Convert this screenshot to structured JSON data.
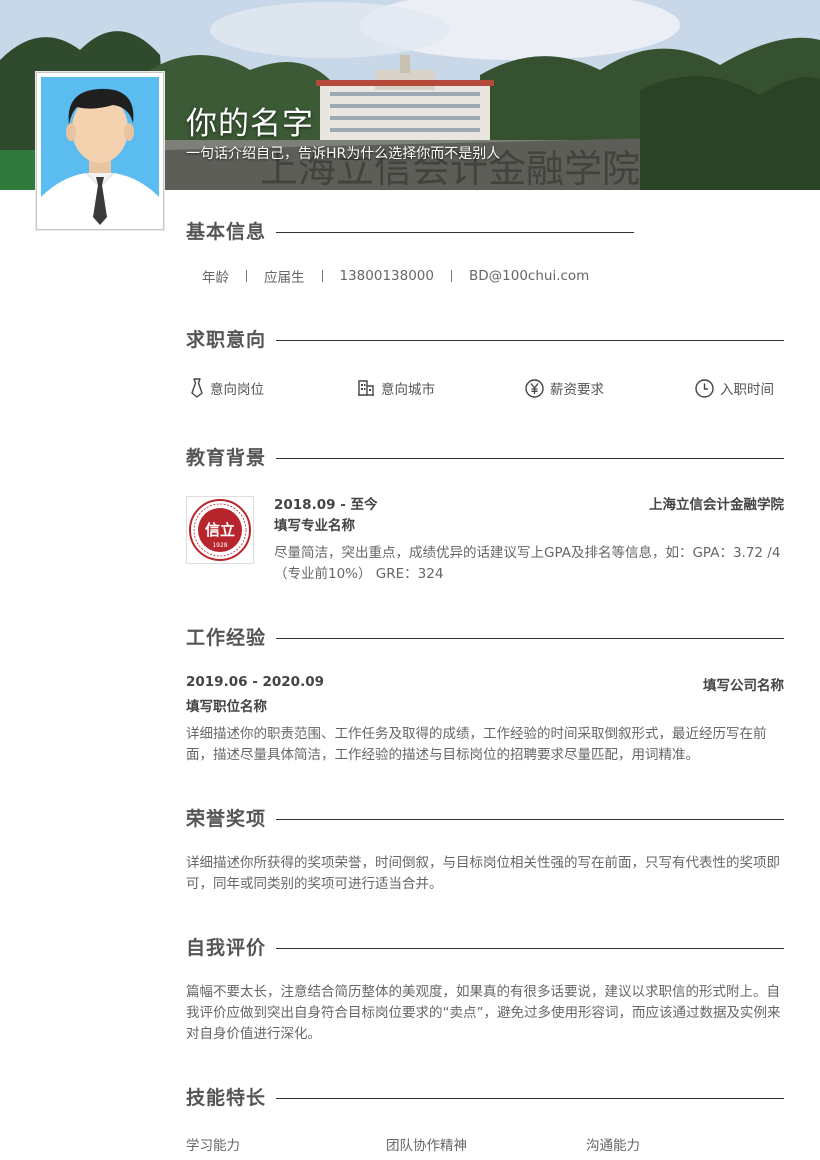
{
  "header": {
    "name": "你的名字",
    "tagline": "一句话介绍自己，告诉HR为什么选择你而不是别人"
  },
  "sections": {
    "basic": "基本信息",
    "intent": "求职意向",
    "education": "教育背景",
    "work": "工作经验",
    "honors": "荣誉奖项",
    "self": "自我评价",
    "skills": "技能特长"
  },
  "basic_info": {
    "age": "年龄",
    "status": "应届生",
    "phone": "13800138000",
    "email": "BD@100chui.com"
  },
  "intent": {
    "position": "意向岗位",
    "city": "意向城市",
    "salary": "薪资要求",
    "start": "入职时间"
  },
  "education": {
    "period": "2018.09 - 至今",
    "school": "上海立信会计金融学院",
    "major": "填写专业名称",
    "desc": "尽量简洁，突出重点，成绩优异的话建议写上GPA及排名等信息，如：GPA：3.72 /4（专业前10%） GRE：324",
    "seal_year": "1928"
  },
  "work": {
    "period": "2019.06 - 2020.09",
    "company": "填写公司名称",
    "position": "填写职位名称",
    "desc": "详细描述你的职责范围、工作任务及取得的成绩，工作经验的时间采取倒叙形式，最近经历写在前面，描述尽量具体简洁，工作经验的描述与目标岗位的招聘要求尽量匹配，用词精准。"
  },
  "honors": {
    "desc": "详细描述你所获得的奖项荣誉，时间倒叙，与目标岗位相关性强的写在前面，只写有代表性的奖项即可，同年或同类别的奖项可进行适当合并。"
  },
  "self_eval": {
    "desc": "篇幅不要太长，注意结合简历整体的美观度，如果真的有很多话要说，建议以求职信的形式附上。自我评价应做到突出自身符合目标岗位要求的“卖点”，避免过多使用形容词，而应该通过数据及实例来对自身价值进行深化。"
  },
  "skills": [
    "学习能力",
    "团队协作精神",
    "沟通能力"
  ],
  "colors": {
    "accent": "#333333",
    "seal": "#b8262d",
    "avatar_bg": "#5bbcf0"
  },
  "icons": {
    "position": "tie-icon",
    "city": "building-icon",
    "salary": "yen-icon",
    "start": "clock-icon"
  }
}
